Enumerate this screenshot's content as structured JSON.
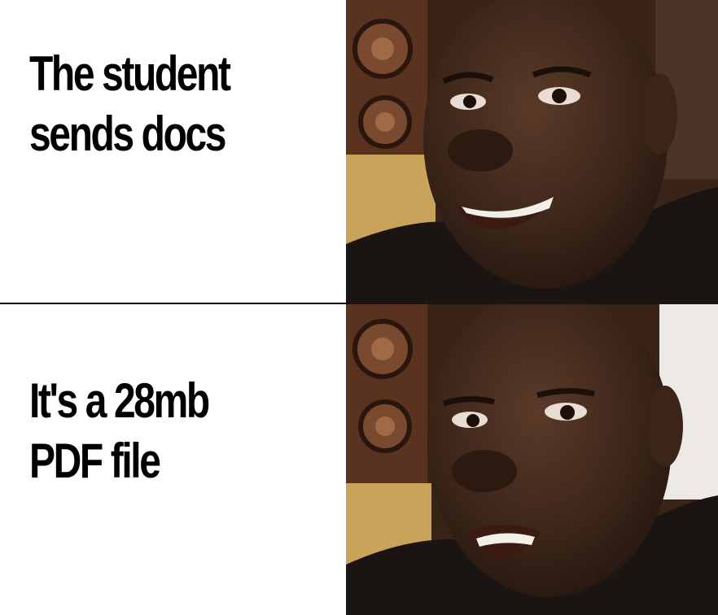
{
  "meme": {
    "panels": [
      {
        "caption_lines": [
          "The student",
          "sends docs"
        ],
        "reaction": "happy-smiling-man"
      },
      {
        "caption_lines": [
          "It's a 28mb",
          "PDF file"
        ],
        "reaction": "disappointed-man"
      }
    ]
  },
  "colors": {
    "background": "#ffffff",
    "text": "#000000",
    "divider": "#000000",
    "skin": "#3b2519",
    "shirt": "#1a1412",
    "carving": "#5a3220",
    "cushion": "#c9a35a",
    "wall": "#ece9e6"
  }
}
